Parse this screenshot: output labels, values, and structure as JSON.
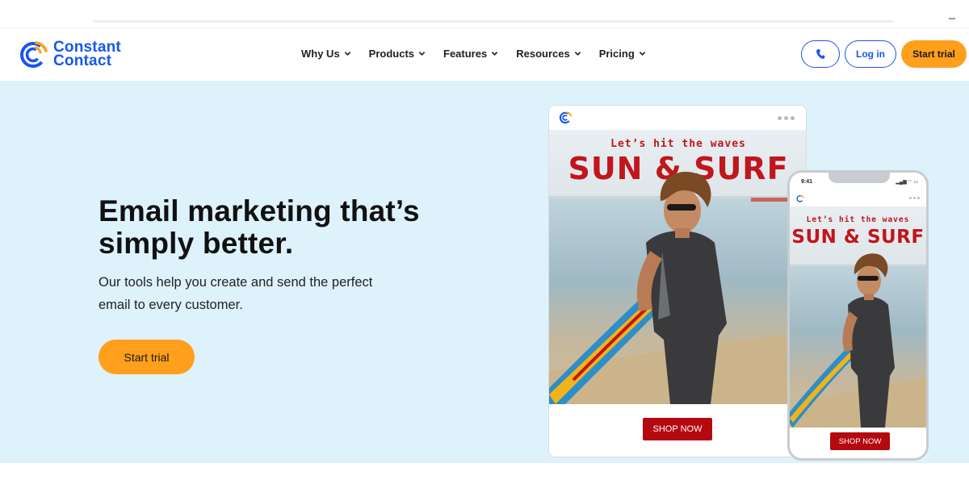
{
  "header": {
    "brand_line1": "Constant",
    "brand_line2": "Contact",
    "nav": [
      {
        "label": "Why Us"
      },
      {
        "label": "Products"
      },
      {
        "label": "Features"
      },
      {
        "label": "Resources"
      },
      {
        "label": "Pricing"
      }
    ],
    "phone_icon": "phone-icon",
    "login_label": "Log in",
    "trial_label": "Start trial"
  },
  "hero": {
    "title_line1": "Email marketing that’s",
    "title_line2": "simply better.",
    "subtitle_line1": "Our tools help you create and send the perfect",
    "subtitle_line2": "email to every customer.",
    "cta_label": "Start trial"
  },
  "email_preview": {
    "tagline": "Let’s hit the waves",
    "headline": "SUN & SURF",
    "shop_label": "SHOP NOW"
  },
  "phone_preview": {
    "time": "9:41",
    "tagline": "Let’s hit the waves",
    "headline": "SUN & SURF",
    "shop_label": "SHOP NOW"
  },
  "colors": {
    "brand_blue": "#1856ed",
    "accent_orange": "#ff9f1c",
    "hero_bg": "#def2fc",
    "promo_red": "#c0161c"
  }
}
